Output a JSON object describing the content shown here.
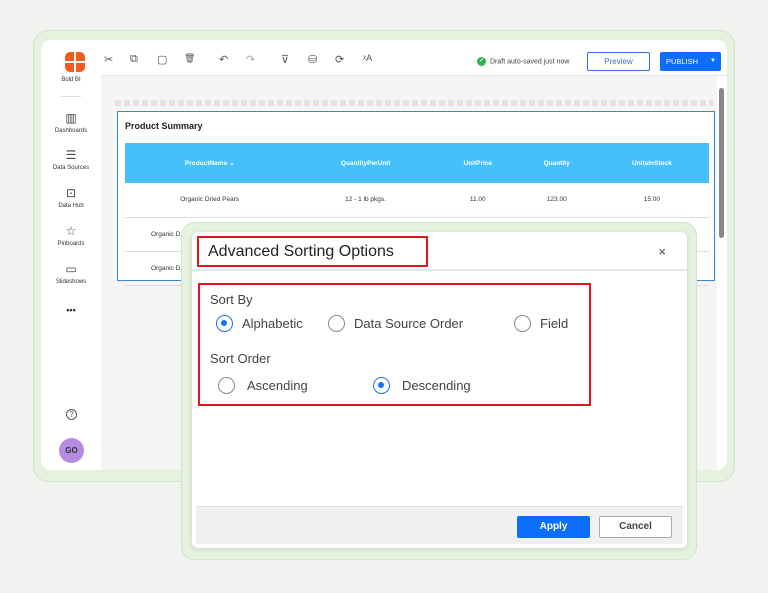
{
  "app": {
    "brand": "Bold BI",
    "nav": [
      {
        "label": "Dashboards",
        "icon": "bar-chart-icon"
      },
      {
        "label": "Data Sources",
        "icon": "database-icon"
      },
      {
        "label": "Data Hub",
        "icon": "data-hub-icon"
      },
      {
        "label": "Pinboards",
        "icon": "pin-icon"
      },
      {
        "label": "Slideshows",
        "icon": "tv-icon"
      }
    ],
    "more": "•••",
    "help": "?",
    "avatar": "GO"
  },
  "toolbar": {
    "icons": {
      "cut": "✂",
      "copy": "⧉",
      "paste": "▢",
      "delete": "🗑",
      "undo": "↶",
      "redo": "↷",
      "filter": "⊽",
      "datasource": "⛁",
      "refresh": "⟳",
      "translate": "ᵡA"
    },
    "status": "Draft auto-saved just now",
    "preview": "Preview",
    "publish": "PUBLISH"
  },
  "widget": {
    "title": "Product Summary",
    "columns": [
      "ProductName",
      "QuantityPerUnit",
      "UnitPrice",
      "Quantity",
      "UnitsInStock"
    ],
    "rows": [
      [
        "Organic Dried Pears",
        "12 - 1 lb pkgs.",
        "11.00",
        "123.00",
        "15.00"
      ],
      [
        "Organic D",
        "",
        "",
        "",
        ""
      ],
      [
        "Organic D",
        "",
        "",
        "",
        ""
      ]
    ]
  },
  "dialog": {
    "title": "Advanced Sorting Options",
    "close": "×",
    "sort_by_label": "Sort By",
    "sort_by_options": [
      "Alphabetic",
      "Data Source Order",
      "Field"
    ],
    "sort_by_selected": "Alphabetic",
    "sort_order_label": "Sort Order",
    "sort_order_options": [
      "Ascending",
      "Descending"
    ],
    "sort_order_selected": "Descending",
    "apply": "Apply",
    "cancel": "Cancel"
  },
  "colors": {
    "accent": "#0d6efd",
    "header": "#45c0fb",
    "highlight": "#e0161e",
    "brand": "#f25a1f"
  }
}
